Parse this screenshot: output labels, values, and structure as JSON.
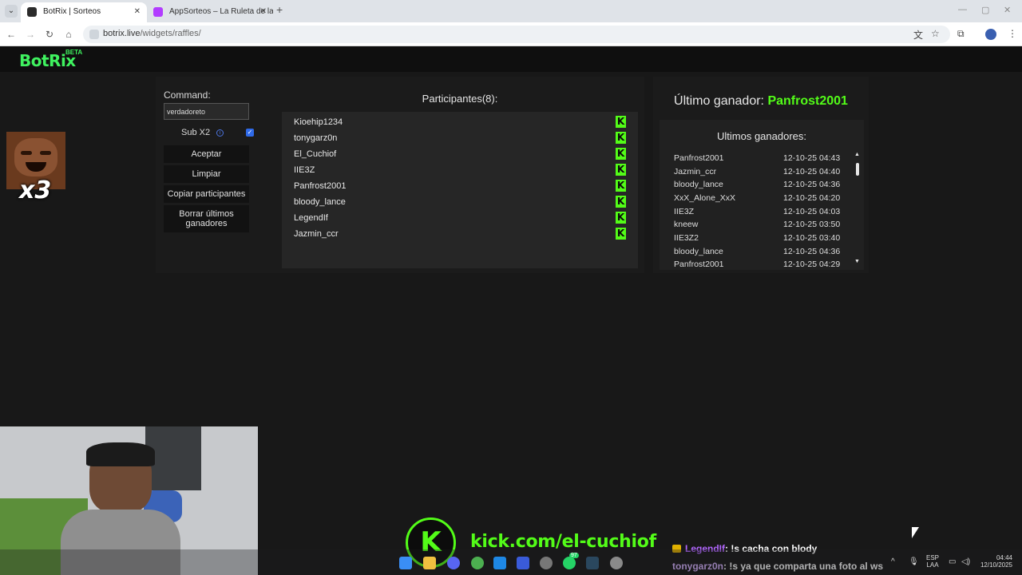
{
  "browser": {
    "tabs": [
      {
        "title": "BotRix | Sorteos",
        "active": true,
        "favicon_color": "#2b2b2b"
      },
      {
        "title": "AppSorteos – La Ruleta de la S",
        "active": false,
        "favicon_color": "#b23cff"
      }
    ],
    "url_host": "botrix.live",
    "url_path": "/widgets/raffles/"
  },
  "site": {
    "logo": "BotRix",
    "logo_badge": "BETA",
    "brand_color": "#3ff25f"
  },
  "raffle": {
    "command_label": "Command:",
    "command_value": "verdadoreto",
    "sub_label": "Sub X2",
    "sub_checked": true,
    "buttons": {
      "accept": "Aceptar",
      "clear": "Limpiar",
      "copy": "Copiar participantes",
      "delete_winners": "Borrar últimos ganadores"
    },
    "participants_title": "Participantes(8):",
    "participants": [
      "Kioehip1234",
      "tonygarz0n",
      "El_Cuchiof",
      "IIE3Z",
      "Panfrost2001",
      "bloody_lance",
      "LegendIf",
      "Jazmin_ccr"
    ]
  },
  "winners_panel": {
    "last_winner_label": "Último ganador:",
    "last_winner_name": "Panfrost2001",
    "recent_title": "Ultimos ganadores:",
    "recent": [
      {
        "name": "Panfrost2001",
        "date": "12-10-25 04:43"
      },
      {
        "name": "Jazmin_ccr",
        "date": "12-10-25 04:40"
      },
      {
        "name": "bloody_lance",
        "date": "12-10-25 04:36"
      },
      {
        "name": "XxX_Alone_XxX",
        "date": "12-10-25 04:20"
      },
      {
        "name": "IIE3Z",
        "date": "12-10-25 04:03"
      },
      {
        "name": "kneew",
        "date": "12-10-25 03:50"
      },
      {
        "name": "IIE3Z2",
        "date": "12-10-25 03:40"
      },
      {
        "name": "bloody_lance",
        "date": "12-10-25 04:36"
      },
      {
        "name": "Panfrost2001",
        "date": "12-10-25 04:29"
      }
    ]
  },
  "overlay": {
    "emote_label": "x3",
    "kick_url": "kick.com/el-cuchiof",
    "chat": [
      {
        "user": "LegendIf",
        "message": ": !s cacha con blody"
      },
      {
        "user": "tonygarz0n",
        "message": ": !s ya que comparta una foto al ws"
      }
    ]
  },
  "taskbar": {
    "lang_top": "ESP",
    "lang_bottom": "LAA",
    "time": "04:44",
    "date": "12/10/2025",
    "badge_count": "97"
  }
}
